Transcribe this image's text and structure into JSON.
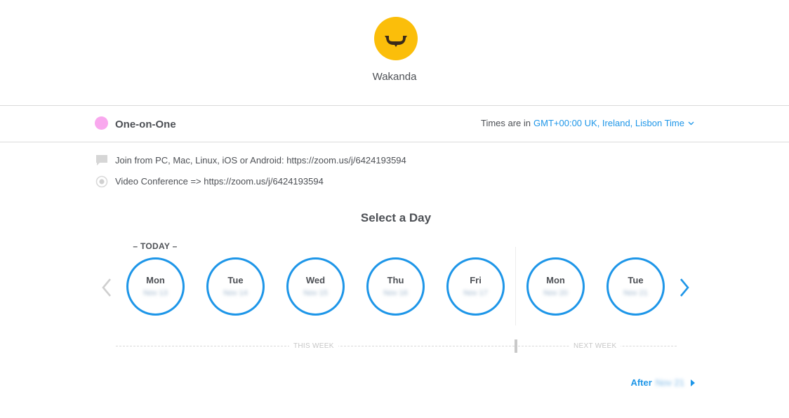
{
  "header": {
    "org_name": "Wakanda",
    "logo_color": "#fbbe0a"
  },
  "event": {
    "name": "One-on-One",
    "color": "#f9a8ee"
  },
  "timezone": {
    "prefix": "Times are in",
    "value": "GMT+00:00 UK, Ireland, Lisbon Time"
  },
  "details": [
    {
      "icon": "chat-bubble-icon",
      "text": "Join from PC, Mac, Linux, iOS or Android: https://zoom.us/j/6424193594"
    },
    {
      "icon": "location-pin-icon",
      "text": "Video Conference => https://zoom.us/j/6424193594"
    }
  ],
  "calendar": {
    "heading": "Select a Day",
    "today_label": "– TODAY –",
    "days": [
      {
        "name": "Mon",
        "date": "Nov 13"
      },
      {
        "name": "Tue",
        "date": "Nov 14"
      },
      {
        "name": "Wed",
        "date": "Nov 15"
      },
      {
        "name": "Thu",
        "date": "Nov 16"
      },
      {
        "name": "Fri",
        "date": "Nov 17"
      },
      {
        "name": "Mon",
        "date": "Nov 20"
      },
      {
        "name": "Tue",
        "date": "Nov 21"
      }
    ],
    "this_week_label": "THIS WEEK",
    "next_week_label": "NEXT WEEK"
  },
  "pager": {
    "after_label": "After",
    "after_date": "Nov 21"
  },
  "colors": {
    "accent": "#1e96e8",
    "text": "#4d5055"
  }
}
